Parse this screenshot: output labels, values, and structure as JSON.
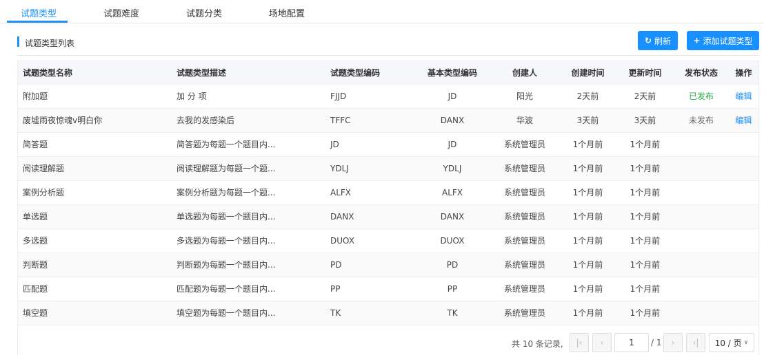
{
  "tabs": [
    {
      "label": "试题类型",
      "active": true
    },
    {
      "label": "试题难度",
      "active": false
    },
    {
      "label": "试题分类",
      "active": false
    },
    {
      "label": "场地配置",
      "active": false
    }
  ],
  "list_title": "试题类型列表",
  "toolbar": {
    "refresh_label": "刷新",
    "refresh_icon": "refresh-icon",
    "add_label": "添加试题类型",
    "add_icon": "plus-icon"
  },
  "colors": {
    "accent": "#1890ff",
    "published": "#28a745"
  },
  "table": {
    "headers": [
      "试题类型名称",
      "试题类型描述",
      "试题类型编码",
      "基本类型编码",
      "创建人",
      "创建时间",
      "更新时间",
      "发布状态",
      "操作"
    ],
    "rows": [
      [
        "附加题",
        "加 分 项",
        "FJJD",
        "JD",
        "阳光",
        "2天前",
        "2天前",
        "已发布",
        "编辑"
      ],
      [
        "废墟雨夜惊魂v明白你",
        "去我的发感染后",
        "TFFC",
        "DANX",
        "华波",
        "3天前",
        "3天前",
        "未发布",
        "编辑"
      ],
      [
        "简答题",
        "简答题为每题一个题目内...",
        "JD",
        "JD",
        "系统管理员",
        "1个月前",
        "1个月前",
        "",
        ""
      ],
      [
        "阅读理解题",
        "阅读理解题为每题一个题...",
        "YDLJ",
        "YDLJ",
        "系统管理员",
        "1个月前",
        "1个月前",
        "",
        ""
      ],
      [
        "案例分析题",
        "案例分析题为每题一个题...",
        "ALFX",
        "ALFX",
        "系统管理员",
        "1个月前",
        "1个月前",
        "",
        ""
      ],
      [
        "单选题",
        "单选题为每题一个题目内...",
        "DANX",
        "DANX",
        "系统管理员",
        "1个月前",
        "1个月前",
        "",
        ""
      ],
      [
        "多选题",
        "多选题为每题一个题目内...",
        "DUOX",
        "DUOX",
        "系统管理员",
        "1个月前",
        "1个月前",
        "",
        ""
      ],
      [
        "判断题",
        "判断题为每题一个题目内...",
        "PD",
        "PD",
        "系统管理员",
        "1个月前",
        "1个月前",
        "",
        ""
      ],
      [
        "匹配题",
        "匹配题为每题一个题目内...",
        "PP",
        "PP",
        "系统管理员",
        "1个月前",
        "1个月前",
        "",
        ""
      ],
      [
        "填空题",
        "填空题为每题一个题目内...",
        "TK",
        "TK",
        "系统管理员",
        "1个月前",
        "1个月前",
        "",
        ""
      ]
    ]
  },
  "pagination": {
    "total_text": "共 10 条记录,",
    "current_page": "1",
    "total_pages_text": "/ 1",
    "page_size_text": "10 / 页"
  }
}
